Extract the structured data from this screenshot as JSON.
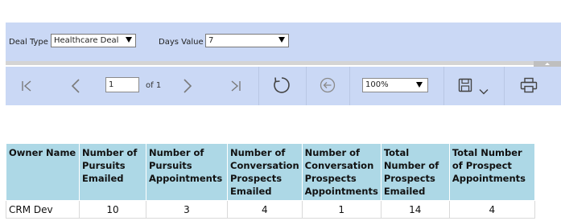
{
  "params": {
    "deal_type_label": "Deal Type",
    "deal_type_value": "Healthcare Deal",
    "days_value_label": "Days Value",
    "days_value_value": "7"
  },
  "toolbar": {
    "current_page": "1",
    "of_pages": "of 1",
    "zoom": "100%",
    "icons": [
      "first-page-icon",
      "previous-page-icon",
      "next-page-icon",
      "last-page-icon",
      "refresh-icon",
      "back-icon",
      "save-icon",
      "chevron-down-icon",
      "print-icon"
    ]
  },
  "colors": {
    "toolbar_bg": "#cad8f5",
    "header_bg": "#add8e6"
  },
  "report": {
    "columns": [
      "Owner Name",
      "Number of Pursuits Emailed",
      "Number of Pursuits Appointments",
      "Number of Conversation Prospects Emailed",
      "Number of Conversation Prospects Appointments",
      "Total Number of Prospects Emailed",
      "Total Number of Prospect Appointments"
    ],
    "rows": [
      [
        "CRM Dev",
        "10",
        "3",
        "4",
        "1",
        "14",
        "4"
      ]
    ]
  }
}
